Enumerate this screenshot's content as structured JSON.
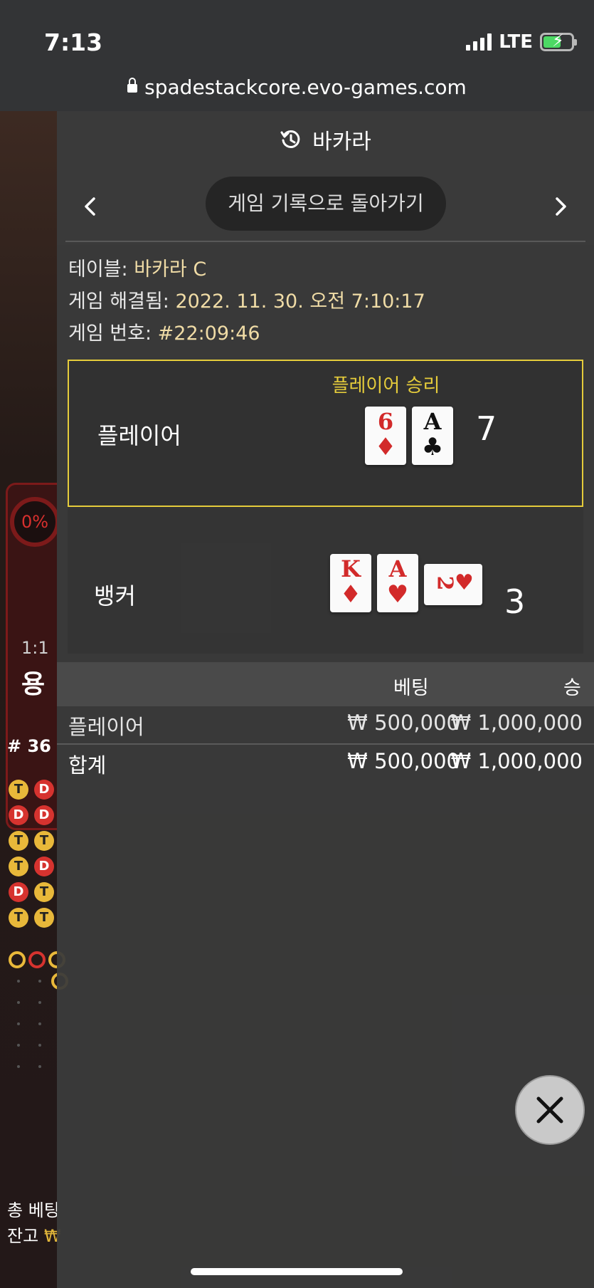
{
  "status_bar": {
    "time": "7:13",
    "network": "LTE"
  },
  "browser": {
    "url": "spadestackcore.evo-games.com"
  },
  "background_game": {
    "percent": "0%",
    "ratio": "1:1",
    "dragon_label": "용",
    "round": "# 36",
    "bead_road": [
      [
        "T",
        "D"
      ],
      [
        "D",
        "D"
      ],
      [
        "T",
        "T"
      ],
      [
        "T",
        "D"
      ],
      [
        "D",
        "T"
      ],
      [
        "T",
        "T"
      ]
    ],
    "total_bet": "총 베팅",
    "balance_label": "잔고"
  },
  "panel": {
    "title": "바카라",
    "back_label": "게임 기록으로 돌아가기",
    "meta": {
      "table_label": "테이블:",
      "table_value": "바카라 C",
      "resolved_label": "게임 해결됨:",
      "resolved_value": "2022. 11. 30. 오전 7:10:17",
      "number_label": "게임 번호:",
      "number_value": "#22:09:46"
    },
    "winner_label": "플레이어 승리",
    "player": {
      "label": "플레이어",
      "total": "7",
      "cards": [
        {
          "rank": "6",
          "suit": "♦",
          "color": "red"
        },
        {
          "rank": "A",
          "suit": "♣",
          "color": "black"
        }
      ]
    },
    "banker": {
      "label": "뱅커",
      "total": "3",
      "cards": [
        {
          "rank": "K",
          "suit": "♦",
          "color": "red"
        },
        {
          "rank": "A",
          "suit": "♥",
          "color": "red"
        },
        {
          "rank": "2",
          "suit": "♥",
          "color": "red",
          "sideways": true
        }
      ]
    },
    "bets": {
      "bet_header": "베팅",
      "win_header": "승",
      "rows": [
        {
          "name": "플레이어",
          "bet": "₩ 500,000",
          "win": "₩ 1,000,000"
        },
        {
          "name": "합계",
          "bet": "₩ 500,000",
          "win": "₩ 1,000,000"
        }
      ]
    }
  },
  "colors": {
    "winner_gold": "#e5cc3b",
    "meta_value": "#f0dca6",
    "card_red": "#d22a2a",
    "panel_bg": "#3a3a3a"
  },
  "icons": {
    "title": "history-icon",
    "prev": "chevron-left-icon",
    "next": "chevron-right-icon",
    "close": "close-icon"
  }
}
